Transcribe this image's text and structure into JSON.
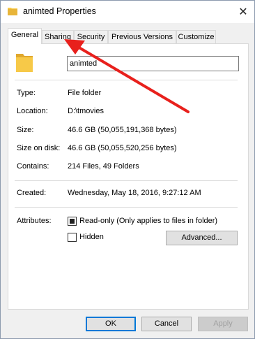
{
  "window": {
    "title": "animted Properties",
    "close_glyph": "✕"
  },
  "tabs": [
    {
      "label": "General",
      "active": true
    },
    {
      "label": "Sharing",
      "active": false
    },
    {
      "label": "Security",
      "active": false
    },
    {
      "label": "Previous Versions",
      "active": false
    },
    {
      "label": "Customize",
      "active": false
    }
  ],
  "general": {
    "name_value": "animted",
    "type_label": "Type:",
    "type_value": "File folder",
    "location_label": "Location:",
    "location_value": "D:\\tmovies",
    "size_label": "Size:",
    "size_value": "46.6 GB (50,055,191,368 bytes)",
    "size_on_disk_label": "Size on disk:",
    "size_on_disk_value": "46.6 GB (50,055,520,256 bytes)",
    "contains_label": "Contains:",
    "contains_value": "214 Files, 49 Folders",
    "created_label": "Created:",
    "created_value": "Wednesday, May 18, 2016, 9:27:12 AM",
    "attributes_label": "Attributes:",
    "readonly_label": "Read-only (Only applies to files in folder)",
    "readonly_state": "indeterminate",
    "hidden_label": "Hidden",
    "hidden_state": "unchecked",
    "advanced_button": "Advanced..."
  },
  "footer": {
    "ok": "OK",
    "cancel": "Cancel",
    "apply": "Apply"
  },
  "colors": {
    "folder": "#f7c948",
    "folder_dark": "#e0a82e",
    "annotation_arrow": "#e8201c",
    "focus_blue": "#0078d7"
  },
  "icons": {
    "title": "folder-icon",
    "big": "folder-icon",
    "close": "close-icon"
  }
}
